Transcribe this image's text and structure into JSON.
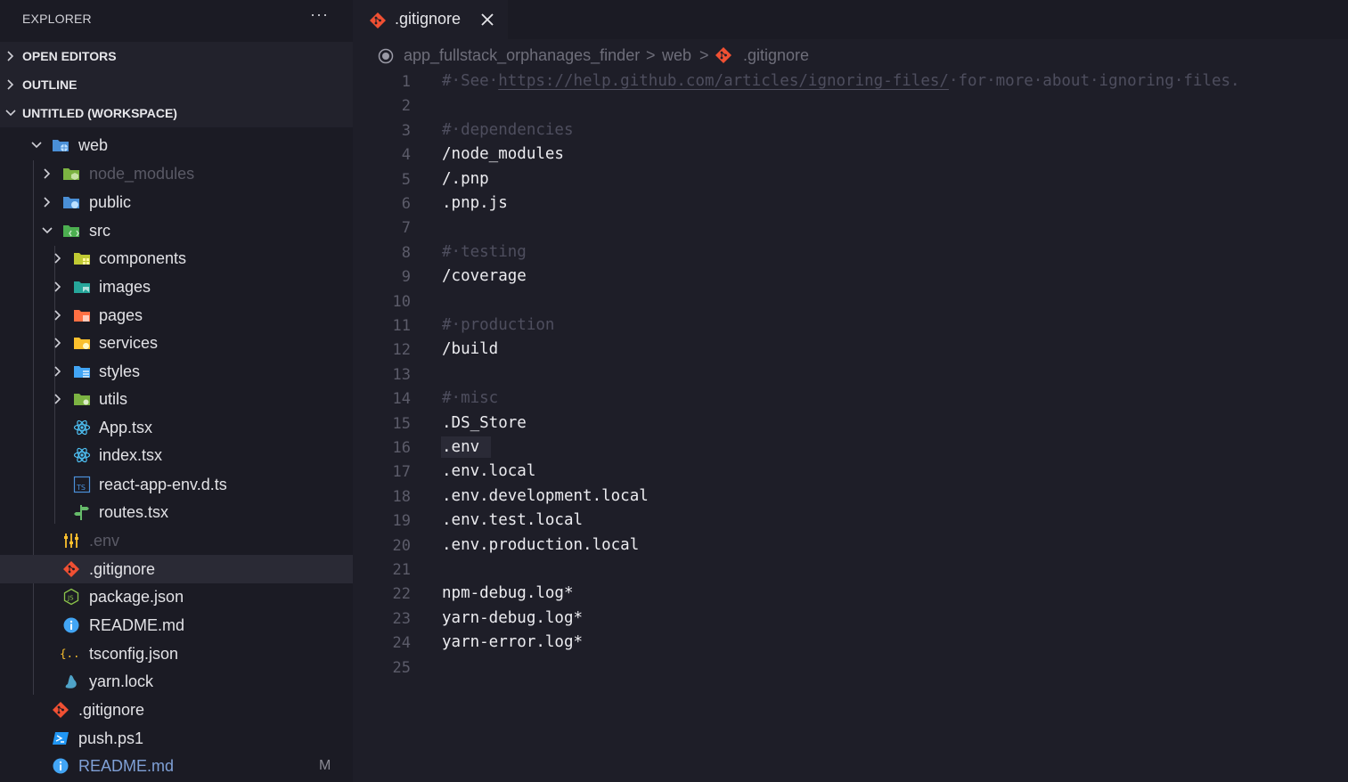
{
  "explorer": {
    "title": "EXPLORER",
    "more": "···",
    "sections": {
      "open_editors": "OPEN EDITORS",
      "outline": "OUTLINE",
      "workspace": "UNTITLED (WORKSPACE)"
    },
    "tree": [
      {
        "name": "web",
        "icon": "folder-web-icon",
        "expanded": true
      },
      {
        "name": "node_modules",
        "icon": "folder-node-icon",
        "expanded": false
      },
      {
        "name": "public",
        "icon": "folder-public-icon",
        "expanded": false
      },
      {
        "name": "src",
        "icon": "folder-src-icon",
        "expanded": true
      },
      {
        "name": "components",
        "icon": "folder-components-icon",
        "expanded": false
      },
      {
        "name": "images",
        "icon": "folder-images-icon",
        "expanded": false
      },
      {
        "name": "pages",
        "icon": "folder-pages-icon",
        "expanded": false
      },
      {
        "name": "services",
        "icon": "folder-services-icon",
        "expanded": false
      },
      {
        "name": "styles",
        "icon": "folder-styles-icon",
        "expanded": false
      },
      {
        "name": "utils",
        "icon": "folder-utils-icon",
        "expanded": false
      },
      {
        "name": "App.tsx",
        "icon": "react-icon"
      },
      {
        "name": "index.tsx",
        "icon": "react-icon"
      },
      {
        "name": "react-app-env.d.ts",
        "icon": "typescript-icon"
      },
      {
        "name": "routes.tsx",
        "icon": "routes-icon"
      },
      {
        "name": ".env",
        "icon": "env-settings-icon"
      },
      {
        "name": ".gitignore",
        "icon": "git-icon"
      },
      {
        "name": "package.json",
        "icon": "nodejs-icon"
      },
      {
        "name": "README.md",
        "icon": "info-icon"
      },
      {
        "name": "tsconfig.json",
        "icon": "json-braces-icon"
      },
      {
        "name": "yarn.lock",
        "icon": "yarn-icon"
      },
      {
        "name": ".gitignore",
        "icon": "git-icon"
      },
      {
        "name": "push.ps1",
        "icon": "powershell-icon"
      },
      {
        "name": "README.md",
        "icon": "info-icon",
        "badge": "M"
      }
    ]
  },
  "tab": {
    "label": ".gitignore",
    "icon": "git-icon",
    "close": "close-icon"
  },
  "breadcrumb": {
    "parts": [
      "app_fullstack_orphanages_finder",
      "web",
      ".gitignore"
    ],
    "separator": ">"
  },
  "editor": {
    "lines": [
      {
        "n": "1",
        "text": "#·See·",
        "link": "https://help.github.com/articles/ignoring-files/",
        "rest": "·for·more·about·ignoring·files.",
        "comment": true
      },
      {
        "n": "2",
        "text": ""
      },
      {
        "n": "3",
        "text": "#·dependencies",
        "comment": true
      },
      {
        "n": "4",
        "text": "/node_modules"
      },
      {
        "n": "5",
        "text": "/.pnp"
      },
      {
        "n": "6",
        "text": ".pnp.js"
      },
      {
        "n": "7",
        "text": ""
      },
      {
        "n": "8",
        "text": "#·testing",
        "comment": true
      },
      {
        "n": "9",
        "text": "/coverage"
      },
      {
        "n": "10",
        "text": ""
      },
      {
        "n": "11",
        "text": "#·production",
        "comment": true
      },
      {
        "n": "12",
        "text": "/build"
      },
      {
        "n": "13",
        "text": ""
      },
      {
        "n": "14",
        "text": "#·misc",
        "comment": true
      },
      {
        "n": "15",
        "text": ".DS_Store"
      },
      {
        "n": "16",
        "text": ".env"
      },
      {
        "n": "17",
        "text": ".env.local"
      },
      {
        "n": "18",
        "text": ".env.development.local"
      },
      {
        "n": "19",
        "text": ".env.test.local"
      },
      {
        "n": "20",
        "text": ".env.production.local"
      },
      {
        "n": "21",
        "text": ""
      },
      {
        "n": "22",
        "text": "npm-debug.log*"
      },
      {
        "n": "23",
        "text": "yarn-debug.log*"
      },
      {
        "n": "24",
        "text": "yarn-error.log*"
      },
      {
        "n": "25",
        "text": ""
      }
    ]
  },
  "colors": {
    "accent_git": "#f05033",
    "background": "#1e1e28",
    "sidebar": "#1b1b24"
  }
}
